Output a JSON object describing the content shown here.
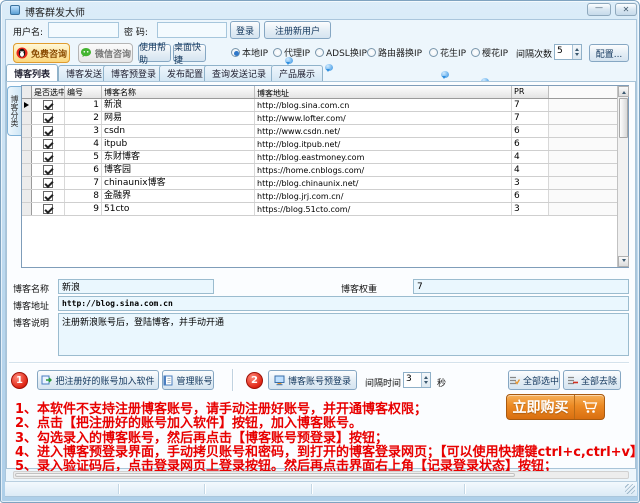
{
  "window": {
    "title": "博客群发大师",
    "minimize_glyph": "—",
    "close_glyph": "✕"
  },
  "login": {
    "username_label": "用户名:",
    "password_label": "密 码:",
    "username_value": "",
    "password_value": "",
    "login_button": "登录",
    "register_button": "注册新用户"
  },
  "toolbar": {
    "qq_button": "免费咨询",
    "wechat_button": "微信咨询",
    "help_button": "使用帮助",
    "shortcut_button": "桌面快捷",
    "ip_options": [
      {
        "label": "本地IP"
      },
      {
        "label": "代理IP"
      },
      {
        "label": "ADSL换IP"
      },
      {
        "label": "路由器换IP"
      },
      {
        "label": "花生IP"
      },
      {
        "label": "樱花IP"
      }
    ],
    "interval_label": "间隔次数",
    "interval_value": "5",
    "config_button": "配置..."
  },
  "tabs": [
    {
      "label": "博客列表"
    },
    {
      "label": "博客发送"
    },
    {
      "label": "博客预登录"
    },
    {
      "label": "发布配置"
    },
    {
      "label": "查询发送记录"
    },
    {
      "label": "产品展示"
    }
  ],
  "side_tab": "博客分类",
  "grid": {
    "headers": [
      "是否选中",
      "编号",
      "博客名称",
      "博客地址",
      "PR"
    ],
    "rows": [
      {
        "num": "1",
        "name": "新浪",
        "url": "http://blog.sina.com.cn",
        "pr": "7"
      },
      {
        "num": "2",
        "name": "网易",
        "url": "http://www.lofter.com/",
        "pr": "7"
      },
      {
        "num": "3",
        "name": "csdn",
        "url": "http://www.csdn.net/",
        "pr": "6"
      },
      {
        "num": "4",
        "name": "itpub",
        "url": "http://blog.itpub.net/",
        "pr": "6"
      },
      {
        "num": "5",
        "name": "东财博客",
        "url": "http://blog.eastmoney.com",
        "pr": "4"
      },
      {
        "num": "6",
        "name": "博客园",
        "url": "https://home.cnblogs.com/",
        "pr": "4"
      },
      {
        "num": "7",
        "name": "chinaunix博客",
        "url": "http://blog.chinaunix.net/",
        "pr": "3"
      },
      {
        "num": "8",
        "name": "金融界",
        "url": "http://blog.jrj.com.cn/",
        "pr": "6"
      },
      {
        "num": "9",
        "name": "51cto",
        "url": "https://blog.51cto.com/",
        "pr": "3"
      }
    ]
  },
  "detail": {
    "name_label": "博客名称",
    "name_value": "新浪",
    "weight_label": "博客权重",
    "weight_value": "7",
    "url_label": "博客地址",
    "url_value": "http://blog.sina.com.cn",
    "desc_label": "博客说明",
    "desc_value": "注册新浪账号后，登陆博客，并手动开通"
  },
  "actions": {
    "step1": "1",
    "add_accounts_button": "把注册好的账号加入软件",
    "manage_accounts_button": "管理账号",
    "step2": "2",
    "prelogin_button": "博客账号预登录",
    "interval_label": "间隔时间",
    "interval_value": "3",
    "seconds_label": "秒",
    "select_all_button": "全部选中",
    "remove_all_button": "全部去除"
  },
  "buy": {
    "label": "立即购买"
  },
  "instructions": [
    "1、本软件不支持注册博客账号，请手动注册好账号，并开通博客权限；",
    "2、点击【把注册好的账号加入软件】按钮，加入博客账号。",
    "3、勾选录入的博客账号，然后再点击【博客账号预登录】按钮；",
    "4、进入博客预登录界面，手动拷贝账号和密码，到打开的博客登录网页；【可以使用快捷键ctrl+c,ctrl+v】",
    "5、录入验证码后，点击登录网页上登录按钮。然后再点击界面右上角【记录登录状态】按钮；"
  ],
  "colors": {
    "buy_orange": "#ec8a24",
    "instruction_red": "#e80000",
    "selected_ip_blue": "#2f77c9"
  },
  "icons": {
    "qq": "qq-icon",
    "wechat": "wechat-icon",
    "cart": "cart-icon",
    "balloon": "help-balloon-icon",
    "add": "add-accounts-icon",
    "manage": "manage-accounts-icon",
    "prelogin": "prelogin-icon",
    "select_all": "select-all-icon",
    "remove_all": "remove-all-icon"
  }
}
